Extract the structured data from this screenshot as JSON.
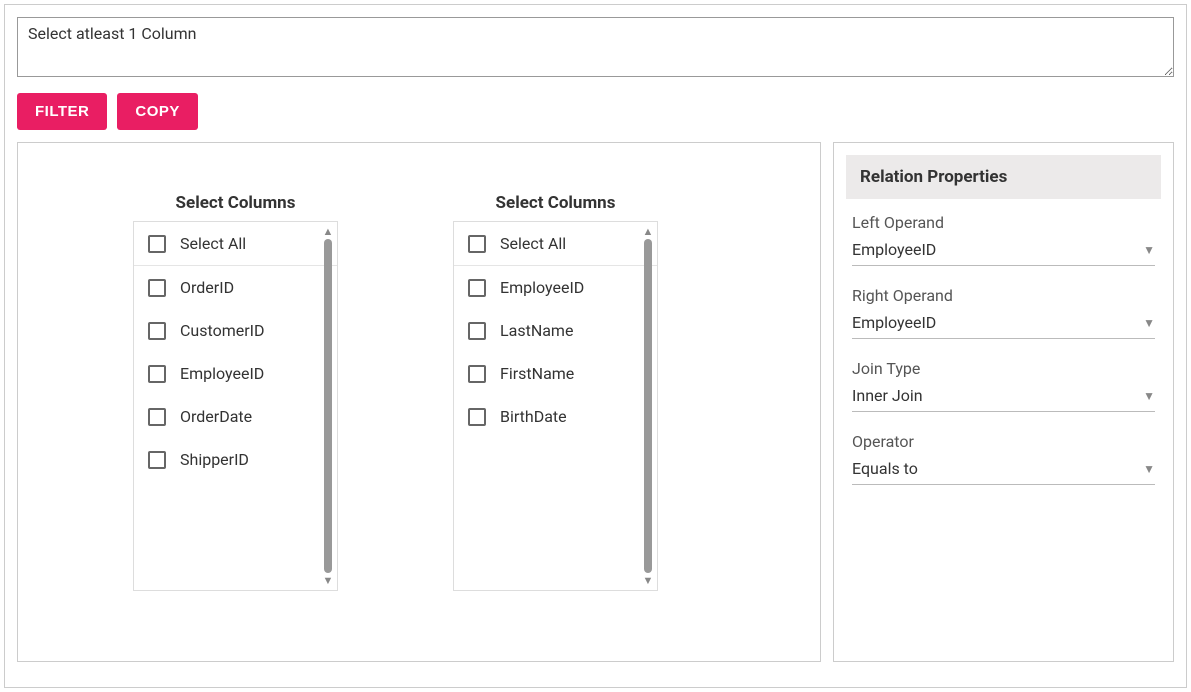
{
  "query_text": "Select atleast 1 Column",
  "buttons": {
    "filter": "FILTER",
    "copy": "COPY"
  },
  "column_list_title": "Select Columns",
  "select_all_label": "Select All",
  "left_columns": [
    "OrderID",
    "CustomerID",
    "EmployeeID",
    "OrderDate",
    "ShipperID"
  ],
  "right_columns": [
    "EmployeeID",
    "LastName",
    "FirstName",
    "BirthDate"
  ],
  "relation": {
    "header": "Relation Properties",
    "labels": {
      "left_operand": "Left Operand",
      "right_operand": "Right Operand",
      "join_type": "Join Type",
      "operator": "Operator"
    },
    "values": {
      "left_operand": "EmployeeID",
      "right_operand": "EmployeeID",
      "join_type": "Inner Join",
      "operator": "Equals to"
    }
  }
}
